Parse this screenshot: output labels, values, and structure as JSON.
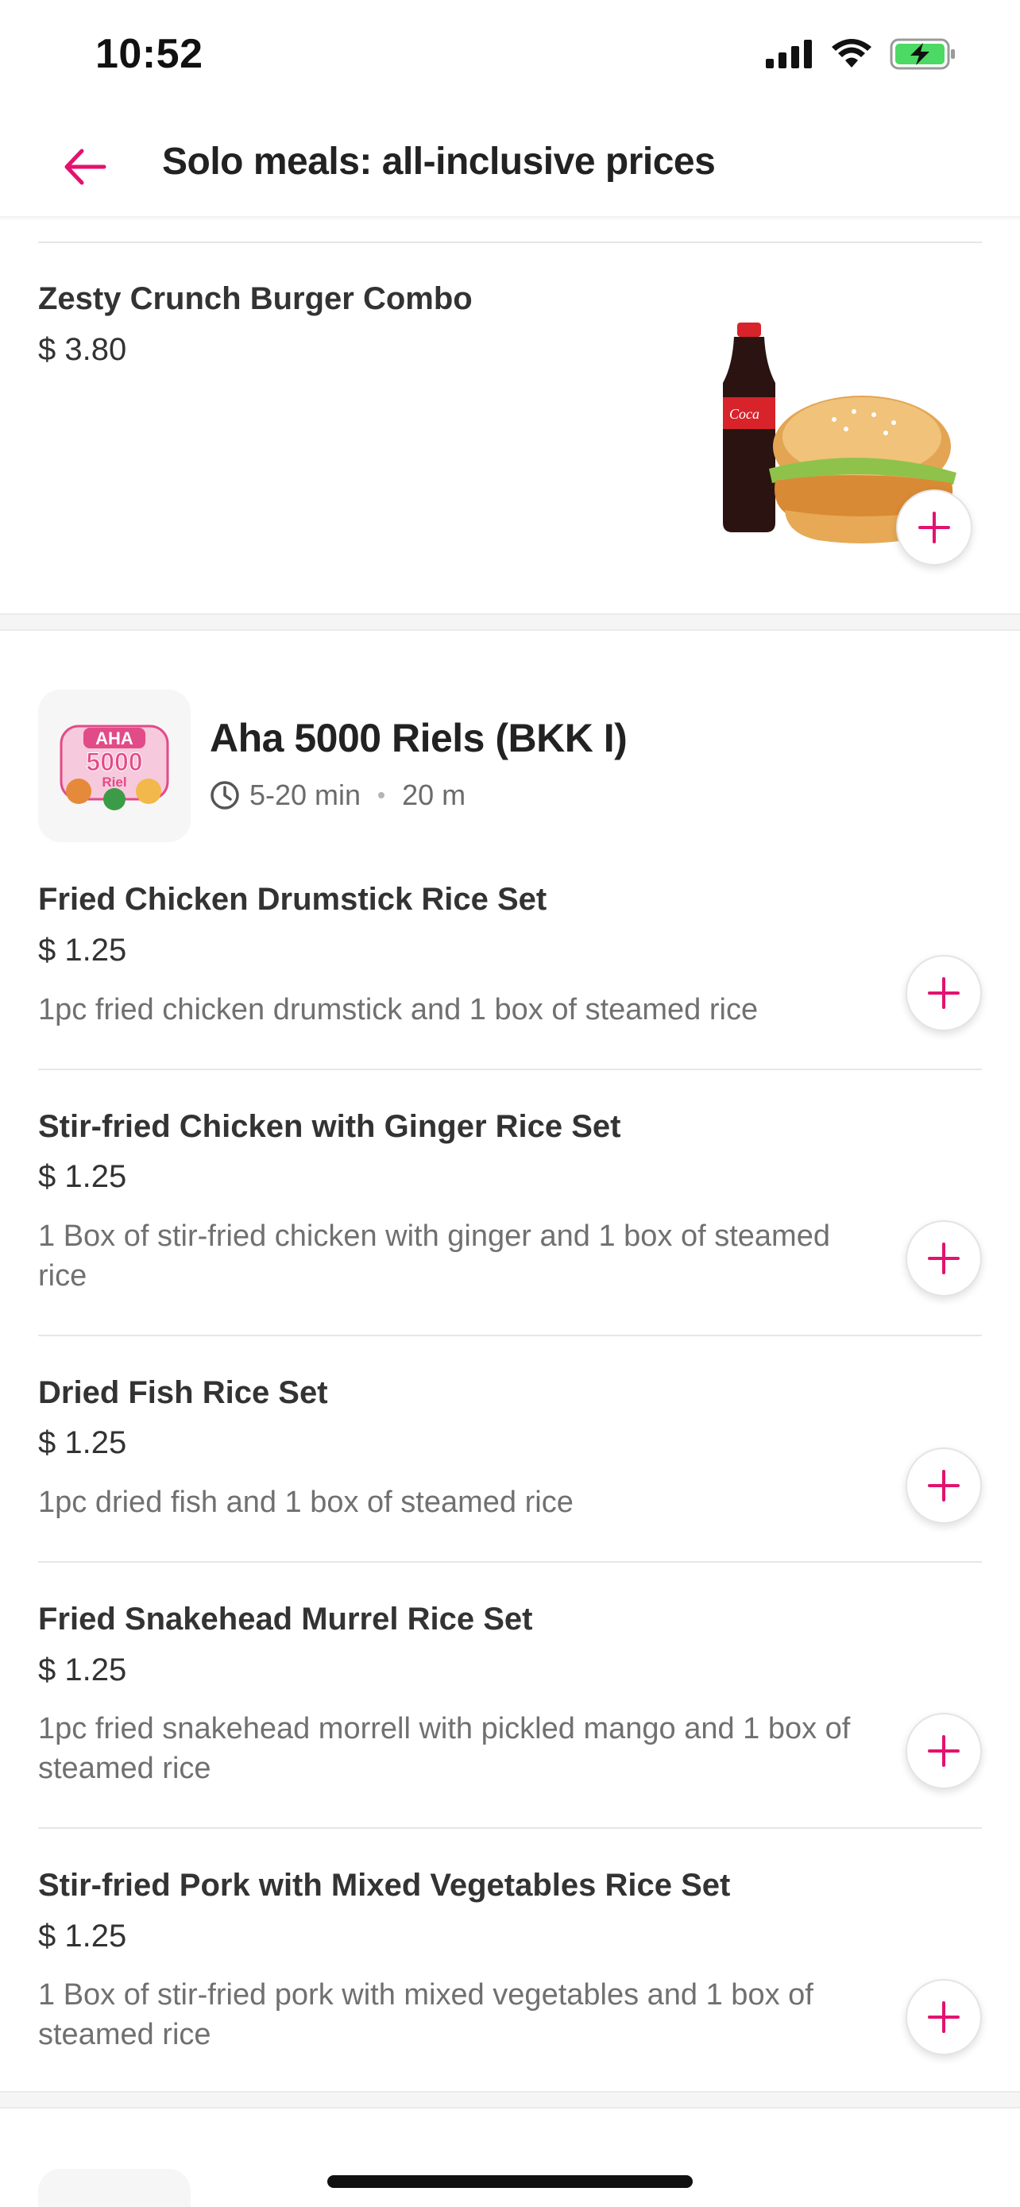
{
  "status_bar": {
    "time": "10:52",
    "icons": [
      "signal-icon",
      "wifi-icon",
      "battery-charging-icon"
    ]
  },
  "header": {
    "back_icon": "arrow-left-icon",
    "title": "Solo meals: all-inclusive prices"
  },
  "colors": {
    "accent": "#E2136E",
    "battery": "#4CD964"
  },
  "featured_item": {
    "name": "Zesty Crunch Burger Combo",
    "price": "$ 3.80",
    "image": "burger-combo-image"
  },
  "vendor": {
    "logo": {
      "line1": "AHA",
      "line2": "5000",
      "line3": "Riel"
    },
    "name": "Aha 5000 Riels (BKK I)",
    "delivery_time": "5-20 min",
    "distance": "20 m"
  },
  "items": [
    {
      "name": "Fried Chicken Drumstick Rice Set",
      "price": "$ 1.25",
      "description": "1pc fried chicken drumstick and 1 box of steamed rice"
    },
    {
      "name": "Stir-fried Chicken with Ginger Rice Set",
      "price": "$ 1.25",
      "description": "1 Box of stir-fried chicken with ginger and 1 box of steamed rice"
    },
    {
      "name": "Dried Fish Rice Set",
      "price": "$ 1.25",
      "description": "1pc dried fish and 1 box of steamed rice"
    },
    {
      "name": "Fried Snakehead Murrel Rice Set",
      "price": "$ 1.25",
      "description": "1pc fried snakehead morrell with pickled mango and 1 box of steamed rice"
    },
    {
      "name": "Stir-fried Pork with Mixed Vegetables Rice Set",
      "price": "$ 1.25",
      "description": "1 Box of stir-fried pork with mixed vegetables and 1 box of steamed rice"
    }
  ]
}
